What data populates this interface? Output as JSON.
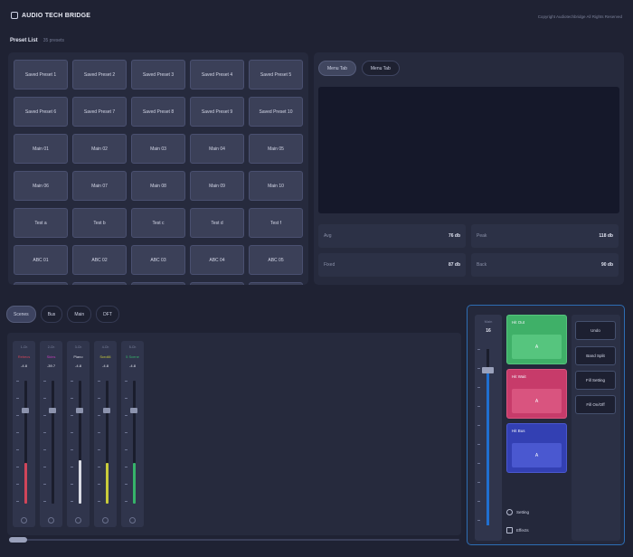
{
  "header": {
    "app_title": "AUDIO TECH BRIDGE",
    "logo_icon": "app-logo-icon",
    "copyright": "Copyright Audiotechbridge All Rights Reserved"
  },
  "preset_list": {
    "title": "Preset List",
    "count": "35 presets",
    "items": [
      "Saved Preset 1",
      "Saved Preset 2",
      "Saved Preset 3",
      "Saved Preset 4",
      "Saved Preset 5",
      "Saved Preset 6",
      "Saved Preset 7",
      "Saved Preset 8",
      "Saved Preset 9",
      "Saved Preset 10",
      "Main 01",
      "Main 02",
      "Main 03",
      "Main 04",
      "Main 05",
      "Main 06",
      "Main 07",
      "Main 08",
      "Main 09",
      "Main 10",
      "Test a",
      "Test b",
      "Test c",
      "Test d",
      "Test f",
      "ABC 01",
      "ABC 02",
      "ABC 03",
      "ABC 04",
      "ABC 05",
      "",
      "",
      "",
      "",
      ""
    ]
  },
  "meter": {
    "tabs": [
      "Menu Tab",
      "Menu Tab"
    ],
    "active_tab": 0,
    "stats": [
      {
        "label": "Avg",
        "value": "76 db"
      },
      {
        "label": "Peak",
        "value": "118 db"
      },
      {
        "label": "Fixed",
        "value": "87 db"
      },
      {
        "label": "Back",
        "value": "90 db"
      }
    ]
  },
  "mixer": {
    "tabs": [
      "Scenes",
      "Bus",
      "Main",
      "DFT"
    ],
    "active_tab": 0,
    "channels": [
      {
        "num": "1-Ch",
        "name": "Rebecs",
        "value": "-4.8",
        "color": "#d0455a",
        "level": 0.33
      },
      {
        "num": "2-Ch",
        "name": "Skins",
        "value": "-39.7",
        "color": "#c23fb9",
        "level": 0.0
      },
      {
        "num": "3-Ch",
        "name": "Piano",
        "value": "-4.8",
        "color": "#d9dbe4",
        "level": 0.35
      },
      {
        "num": "4-Ch",
        "name": "Scroll4",
        "value": "-4.8",
        "color": "#c9cc3b",
        "level": 0.33
      },
      {
        "num": "5-Ch",
        "name": "5 Scene",
        "value": "-4.8",
        "color": "#36b36a",
        "level": 0.33
      }
    ]
  },
  "control": {
    "master_label": "Main",
    "master_value": "16",
    "master_level": 0.88,
    "pads": [
      {
        "label": "Hit Out",
        "value": "A",
        "color": "#3fb068",
        "inner": "#56c57e"
      },
      {
        "label": "Hit Wait",
        "value": "A",
        "color": "#c73b6a",
        "inner": "#d9547f"
      },
      {
        "label": "Hit Bus",
        "value": "A",
        "color": "#3340b3",
        "inner": "#4a58d0"
      }
    ],
    "side_buttons": [
      "Undo",
      "Band Split",
      "Fill Setting",
      "Fill On/Off"
    ],
    "bottom_items": [
      {
        "label": "Setting",
        "icon": "gear-icon"
      },
      {
        "label": "Effects",
        "icon": "effects-icon"
      }
    ]
  }
}
